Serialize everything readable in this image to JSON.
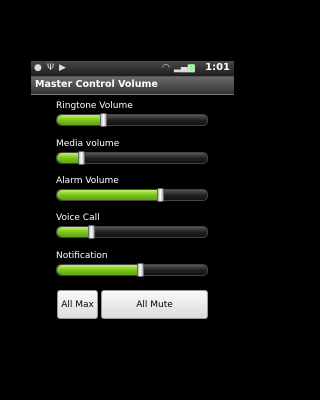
{
  "status": {
    "time": "1:01"
  },
  "title": "Master Control Volume",
  "sliders": [
    {
      "label": "Ringtone Volume",
      "level": 0.3
    },
    {
      "label": "Media volume",
      "level": 0.15
    },
    {
      "label": "Alarm Volume",
      "level": 0.7
    },
    {
      "label": "Voice Call",
      "level": 0.22
    },
    {
      "label": "Notification",
      "level": 0.56
    }
  ],
  "buttons": {
    "all_max": "All Max",
    "all_mute": "All Mute"
  },
  "colors": {
    "accent": "#79c619",
    "background": "#000000"
  },
  "status_icons": [
    "android-icon",
    "usb-icon",
    "play-icon",
    "wifi-icon",
    "signal-icon",
    "battery-icon"
  ]
}
